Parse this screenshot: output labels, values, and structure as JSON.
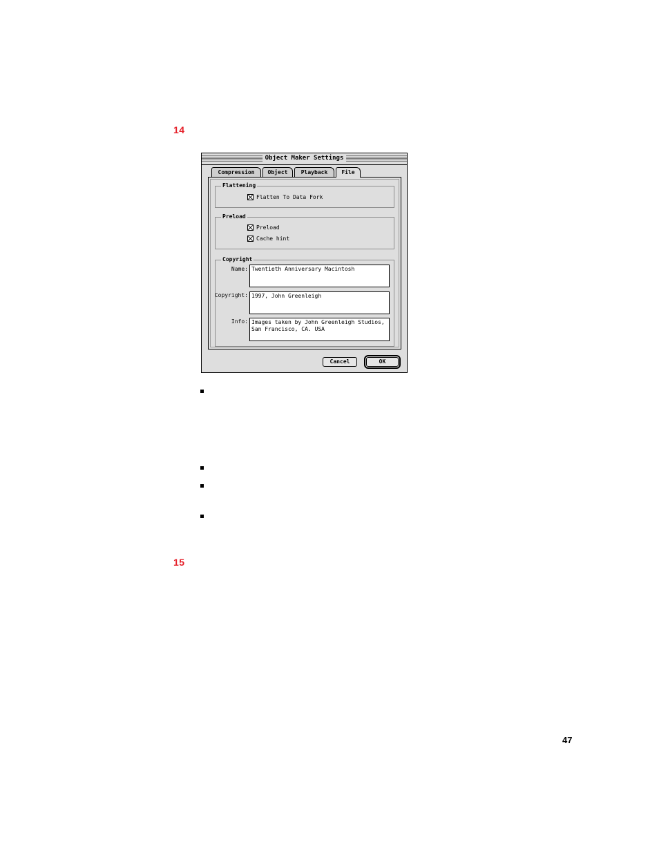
{
  "steps": [
    {
      "number": "14"
    },
    {
      "number": "15"
    }
  ],
  "page": {
    "number": "47"
  },
  "dialog": {
    "title": "Object Maker Settings",
    "tabs": [
      {
        "label": "Compression"
      },
      {
        "label": "Object"
      },
      {
        "label": "Playback"
      },
      {
        "label": "File",
        "active": true
      }
    ],
    "flattening": {
      "title": "Flattening",
      "flatten_to_data_fork": {
        "label": "Flatten To Data Fork",
        "checked": true
      }
    },
    "preload": {
      "title": "Preload",
      "preload": {
        "label": "Preload",
        "checked": true
      },
      "cache_hint": {
        "label": "Cache hint",
        "checked": true
      }
    },
    "copyright": {
      "title": "Copyright",
      "name": {
        "label": "Name:",
        "value": "Twentieth Anniversary Macintosh"
      },
      "copyright": {
        "label": "Copyright:",
        "value": "1997, John Greenleigh"
      },
      "info": {
        "label": "Info:",
        "value": "Images taken by John Greenleigh Studios,\nSan Francisco, CA. USA"
      }
    },
    "buttons": {
      "cancel": "Cancel",
      "ok": "OK"
    }
  }
}
